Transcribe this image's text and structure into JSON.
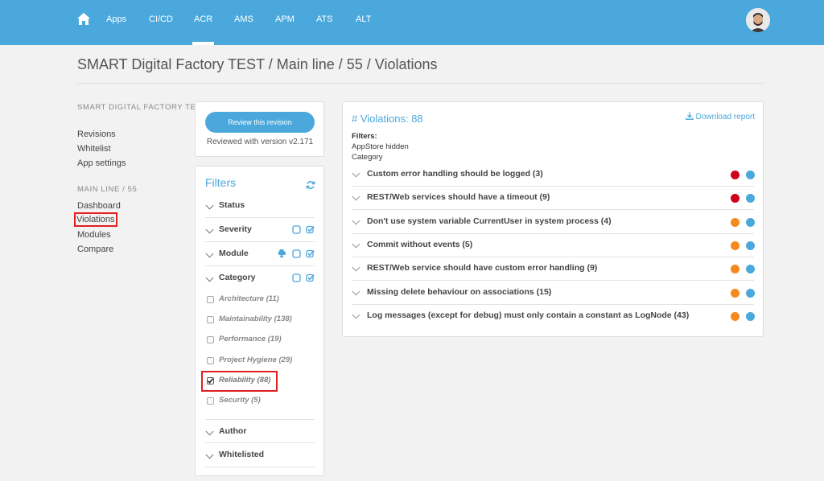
{
  "nav": {
    "items": [
      "Apps",
      "CI/CD",
      "ACR",
      "AMS",
      "APM",
      "ATS",
      "ALT"
    ],
    "active": "ACR"
  },
  "page": {
    "title": "SMART Digital Factory TEST / Main line / 55 / Violations"
  },
  "sidebar": {
    "app_heading": "SMART DIGITAL FACTORY TEST",
    "app_links": [
      "Revisions",
      "Whitelist",
      "App settings"
    ],
    "line_heading": "MAIN LINE / 55",
    "line_links": [
      "Dashboard",
      "Violations",
      "Modules",
      "Compare"
    ],
    "selected": "Violations"
  },
  "review": {
    "button": "Review this revision",
    "note": "Reviewed with version v2.171"
  },
  "filters": {
    "title": "Filters",
    "groups": [
      "Status",
      "Severity",
      "Module",
      "Category",
      "Author",
      "Whitelisted"
    ],
    "categories": [
      {
        "label": "Architecture (11)",
        "checked": false
      },
      {
        "label": "Maintainability (138)",
        "checked": false
      },
      {
        "label": "Performance (19)",
        "checked": false
      },
      {
        "label": "Project Hygiene (29)",
        "checked": false
      },
      {
        "label": "Reliability (88)",
        "checked": true
      },
      {
        "label": "Security (5)",
        "checked": false
      }
    ]
  },
  "violations": {
    "title": "# Violations: 88",
    "download": "Download report",
    "filters_label": "Filters:",
    "active_filters": [
      "AppStore hidden",
      "Category"
    ],
    "severity_colors": {
      "high": "#d0021b",
      "medium": "#f5891f"
    },
    "category_color": "#4aa8dc",
    "rows": [
      {
        "label": "Custom error handling should be logged (3)",
        "severity": "high"
      },
      {
        "label": "REST/Web services should have a timeout (9)",
        "severity": "high"
      },
      {
        "label": "Don't use system variable CurrentUser in system process (4)",
        "severity": "medium"
      },
      {
        "label": "Commit without events (5)",
        "severity": "medium"
      },
      {
        "label": "REST/Web service should have custom error handling (9)",
        "severity": "medium"
      },
      {
        "label": "Missing delete behaviour on associations (15)",
        "severity": "medium"
      },
      {
        "label": "Log messages (except for debug) must only contain a constant as LogNode (43)",
        "severity": "medium"
      }
    ]
  }
}
